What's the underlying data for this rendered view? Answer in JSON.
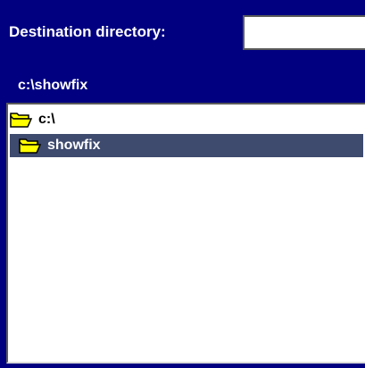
{
  "destination": {
    "label": "Destination directory:",
    "value": "",
    "placeholder": ""
  },
  "current_path": "c:\\showfix",
  "tree": {
    "items": [
      {
        "label": "c:\\",
        "icon": "folder-open-icon",
        "selected": false
      },
      {
        "label": "showfix",
        "icon": "folder-open-icon",
        "selected": true
      }
    ]
  },
  "colors": {
    "background": "#000080",
    "selection": "#3e4a6e",
    "folder": "#ffff00"
  }
}
